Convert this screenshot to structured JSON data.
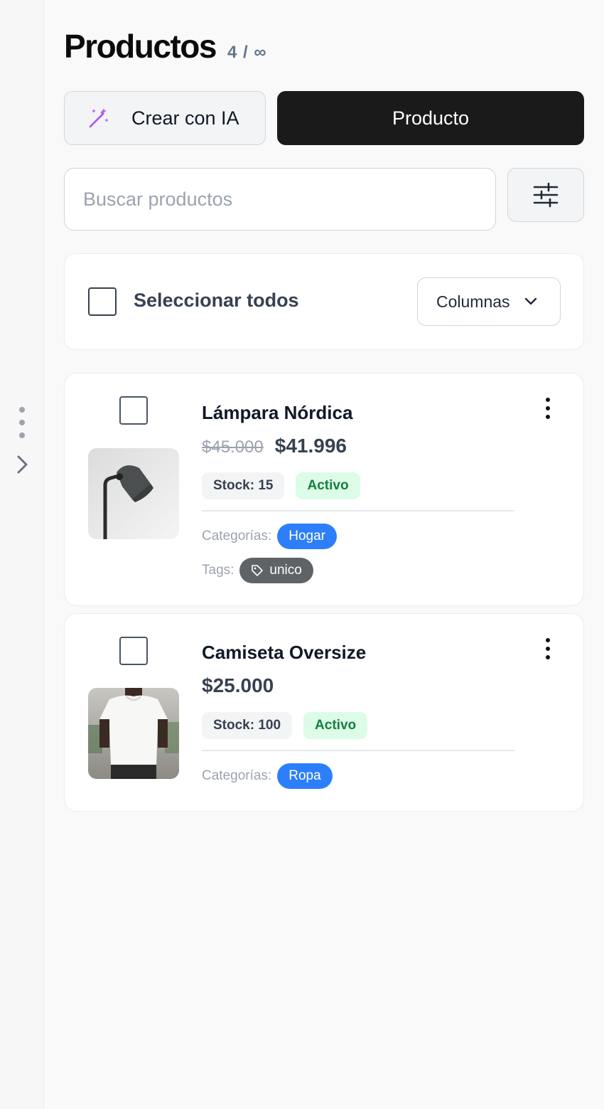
{
  "header": {
    "title": "Productos",
    "count": "4 / ∞"
  },
  "actions": {
    "ai_label": "Crear con IA",
    "product_label": "Producto"
  },
  "search": {
    "placeholder": "Buscar productos",
    "value": ""
  },
  "selection": {
    "select_all_label": "Seleccionar todos",
    "columns_label": "Columnas"
  },
  "labels": {
    "categories": "Categorías:",
    "tags": "Tags:"
  },
  "products": [
    {
      "name": "Lámpara Nórdica",
      "old_price": "$45.000",
      "price": "$41.996",
      "stock": "Stock: 15",
      "status": "Activo",
      "category": "Hogar",
      "tag": "unico",
      "image": "lamp-photo"
    },
    {
      "name": "Camiseta Oversize",
      "price": "$25.000",
      "stock": "Stock: 100",
      "status": "Activo",
      "category": "Ropa",
      "image": "tshirt-photo"
    }
  ],
  "colors": {
    "primary": "#1a1a1a",
    "category_chip": "#2d7ff9",
    "tag_chip": "#5f6368",
    "active_bg": "#dcfce7",
    "active_text": "#15803d",
    "ai_icon": "#a855f7"
  },
  "icons": {
    "ai": "magic-wand-icon",
    "filter": "sliders-icon",
    "columns": "chevron-down-icon",
    "tag": "tag-icon",
    "menu": "more-vertical-icon",
    "rail_toggle": "chevron-right-icon"
  }
}
